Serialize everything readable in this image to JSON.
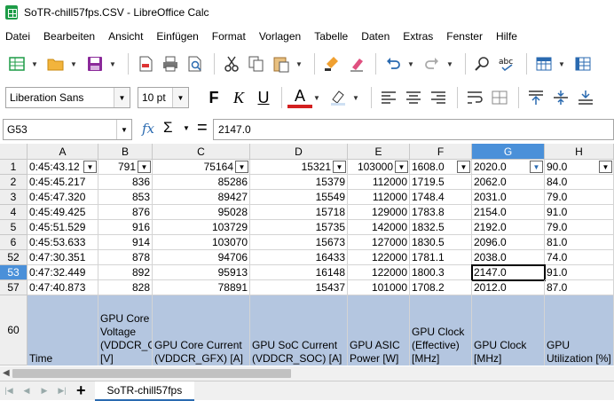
{
  "window": {
    "title": "SoTR-chill57fps.CSV - LibreOffice Calc"
  },
  "menu": [
    "Datei",
    "Bearbeiten",
    "Ansicht",
    "Einfügen",
    "Format",
    "Vorlagen",
    "Tabelle",
    "Daten",
    "Extras",
    "Fenster",
    "Hilfe"
  ],
  "font": {
    "name": "Liberation Sans",
    "size": "10 pt"
  },
  "format_buttons": {
    "bold": "F",
    "italic": "K",
    "underline": "U",
    "font_color": "A"
  },
  "formula": {
    "cell_ref": "G53",
    "fx": "fx",
    "sigma": "Σ",
    "equals": "=",
    "content": "2147.0"
  },
  "columns": [
    "A",
    "B",
    "C",
    "D",
    "E",
    "F",
    "G",
    "H"
  ],
  "selected_column": "G",
  "rows": [
    {
      "num": "1",
      "cells": [
        "0:45:43.12",
        "791",
        "75164",
        "15321",
        "103000",
        "1608.0",
        "2020.0",
        "90.0"
      ]
    },
    {
      "num": "2",
      "cells": [
        "0:45:45.217",
        "836",
        "85286",
        "15379",
        "112000",
        "1719.5",
        "2062.0",
        "84.0"
      ]
    },
    {
      "num": "3",
      "cells": [
        "0:45:47.320",
        "853",
        "89427",
        "15549",
        "112000",
        "1748.4",
        "2031.0",
        "79.0"
      ]
    },
    {
      "num": "4",
      "cells": [
        "0:45:49.425",
        "876",
        "95028",
        "15718",
        "129000",
        "1783.8",
        "2154.0",
        "91.0"
      ]
    },
    {
      "num": "5",
      "cells": [
        "0:45:51.529",
        "916",
        "103729",
        "15735",
        "142000",
        "1832.5",
        "2192.0",
        "79.0"
      ]
    },
    {
      "num": "6",
      "cells": [
        "0:45:53.633",
        "914",
        "103070",
        "15673",
        "127000",
        "1830.5",
        "2096.0",
        "81.0"
      ]
    },
    {
      "num": "52",
      "cells": [
        "0:47:30.351",
        "878",
        "94706",
        "16433",
        "122000",
        "1781.1",
        "2038.0",
        "74.0"
      ]
    },
    {
      "num": "53",
      "cells": [
        "0:47:32.449",
        "892",
        "95913",
        "16148",
        "122000",
        "1800.3",
        "2147.0",
        "91.0"
      ]
    },
    {
      "num": "57",
      "cells": [
        "0:47:40.873",
        "828",
        "78891",
        "15437",
        "101000",
        "1708.2",
        "2012.0",
        "87.0"
      ]
    }
  ],
  "selected_row": "53",
  "header_row": {
    "num": "60",
    "cells": [
      "Time",
      "GPU Core Voltage (VDDCR_GFX) [V]",
      "GPU Core Current (VDDCR_GFX) [A]",
      "GPU SoC Current (VDDCR_SOC) [A]",
      "GPU ASIC Power [W]",
      "GPU Clock (Effective) [MHz]",
      "GPU Clock [MHz]",
      "GPU Utilization [%]"
    ]
  },
  "sheet_tab": "SoTR-chill57fps",
  "colors": {
    "selection": "#4a90d9",
    "header_fill": "#b4c6e0",
    "app_green": "#1d9c47"
  }
}
